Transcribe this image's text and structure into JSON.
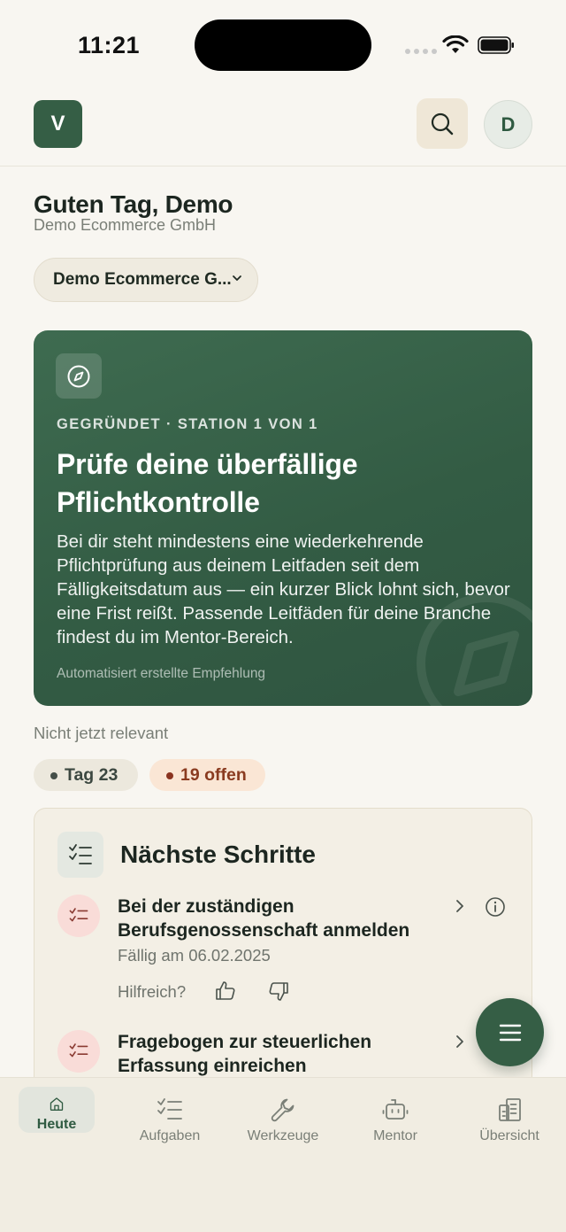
{
  "status_bar": {
    "time": "11:21"
  },
  "header": {
    "logo_letter": "V",
    "avatar_initial": "D"
  },
  "greeting": {
    "title": "Guten Tag, Demo",
    "company": "Demo Ecommerce GmbH",
    "company_select": "Demo Ecommerce G..."
  },
  "hero": {
    "eyebrow": "GEGRÜNDET · STATION 1 VON 1",
    "title": "Prüfe deine überfällige Pflichtkontrolle",
    "body": "Bei dir steht mindestens eine wiederkehrende Pflichtprüfung aus deinem Leitfaden seit dem Fälligkeitsdatum aus — ein kurzer Blick lohnt sich, bevor eine Frist reißt. Passende Leitfäden für deine Branche findest du im Mentor-Bereich.",
    "footnote": "Automatisiert erstellte Empfehlung"
  },
  "dismiss_label": "Nicht jetzt relevant",
  "badges": {
    "day": "Tag 23",
    "open": "19 offen"
  },
  "next_steps": {
    "title": "Nächste Schritte",
    "helpful_label": "Hilfreich?",
    "tasks": [
      {
        "title": "Bei der zuständigen Berufsgenossenschaft anmelden",
        "due": "Fällig am 06.02.2025"
      },
      {
        "title": "Fragebogen zur steuerlichen Erfassung einreichen",
        "due": ""
      }
    ]
  },
  "tabs": [
    {
      "label": "Heute",
      "icon": "home-icon",
      "active": true
    },
    {
      "label": "Aufgaben",
      "icon": "checklist-icon",
      "active": false
    },
    {
      "label": "Werkzeuge",
      "icon": "wrench-icon",
      "active": false
    },
    {
      "label": "Mentor",
      "icon": "robot-icon",
      "active": false
    },
    {
      "label": "Übersicht",
      "icon": "building-icon",
      "active": false
    }
  ],
  "colors": {
    "brand": "#355e45",
    "background": "#f8f6f1",
    "accent_warm": "#fae6d5"
  }
}
